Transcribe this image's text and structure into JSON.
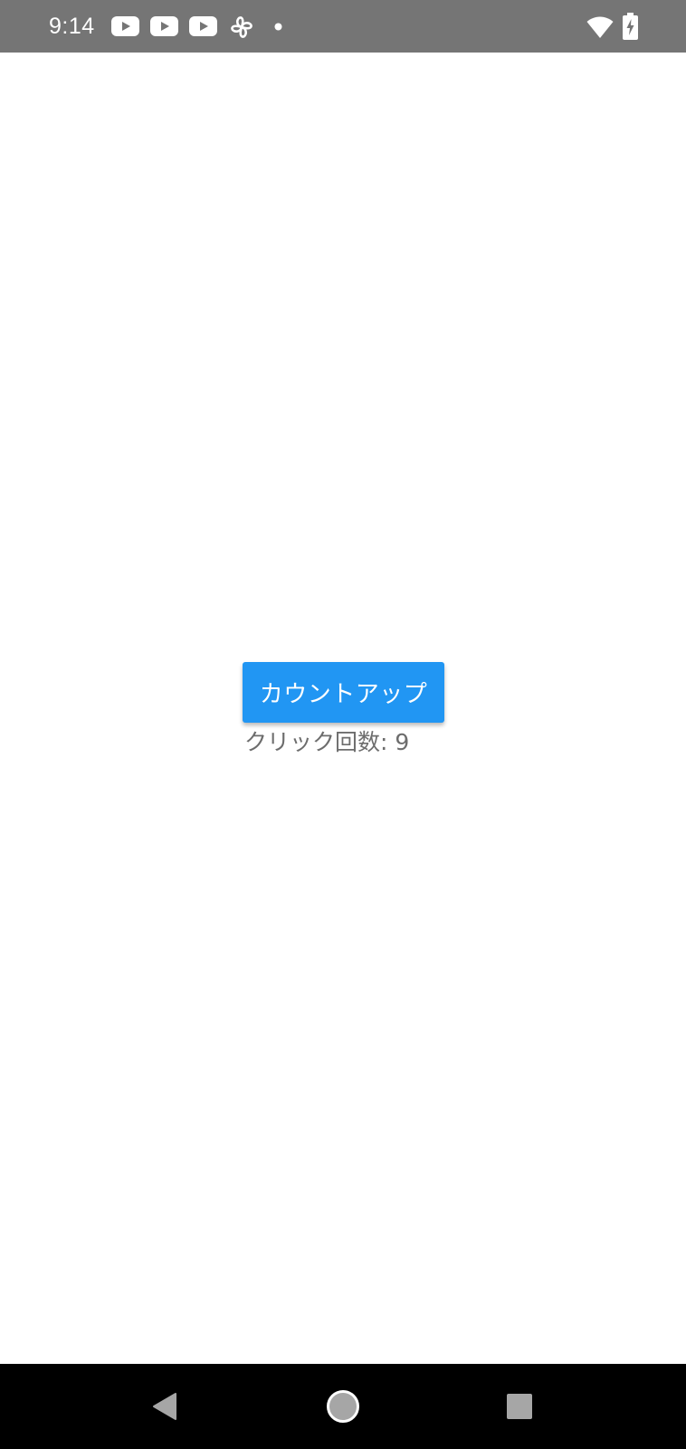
{
  "status_bar": {
    "time": "9:14",
    "icons": [
      "youtube-icon",
      "youtube-icon",
      "youtube-icon",
      "pinwheel-icon",
      "notification-dot-icon",
      "wifi-icon",
      "battery-charging-icon"
    ],
    "background": "#757575"
  },
  "main": {
    "button_label": "カウントアップ",
    "count_text": "クリック回数: 9",
    "accent_color": "#2196F3"
  },
  "nav_bar": {
    "buttons": [
      "back-icon",
      "home-icon",
      "recents-icon"
    ]
  }
}
